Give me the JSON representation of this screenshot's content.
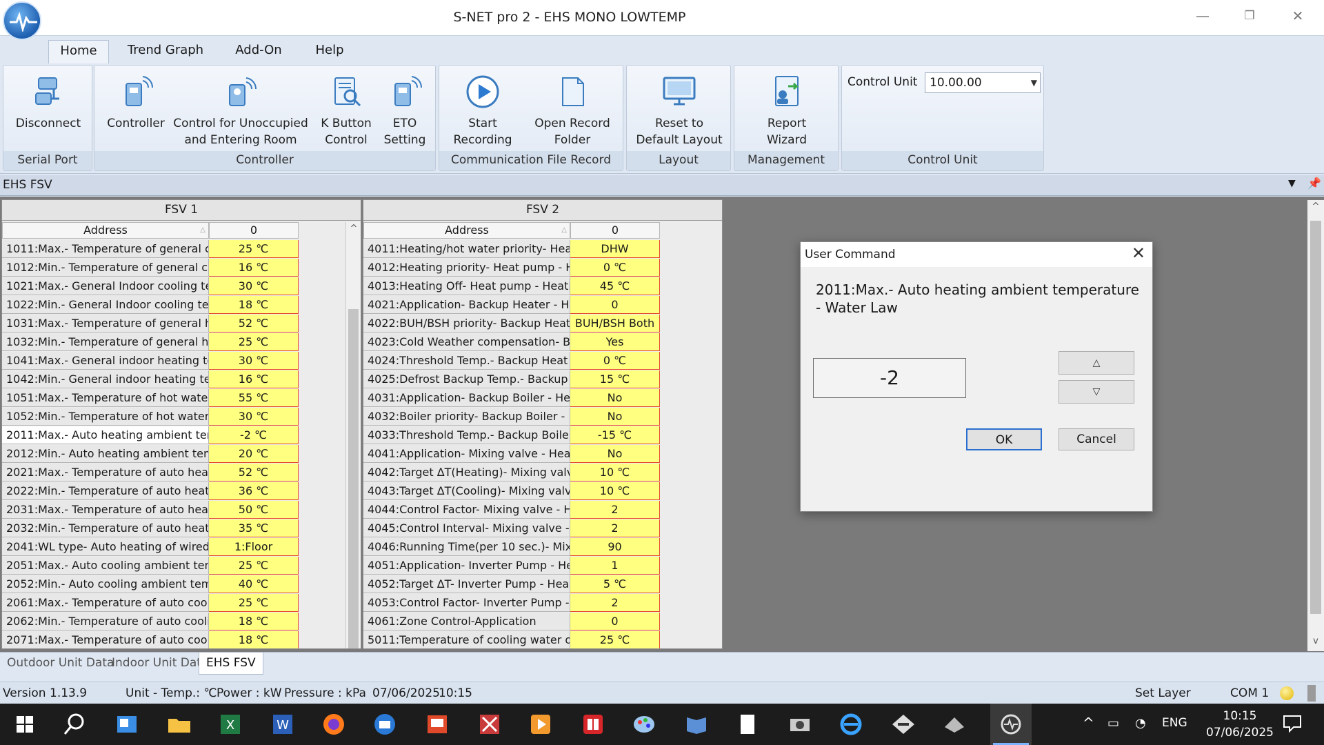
{
  "window": {
    "title": "S-NET pro 2 - EHS MONO LOWTEMP",
    "minimize_glyph": "—",
    "restore_glyph": "❐",
    "close_glyph": "✕"
  },
  "ribbon_tabs": [
    "Home",
    "Trend Graph",
    "Add-On",
    "Help"
  ],
  "ribbon": {
    "groups": {
      "serial_port": "Serial Port",
      "controller": "Controller",
      "communication": "Communication",
      "file_record": "File Record",
      "layout": "Layout",
      "management": "Management",
      "control_unit": "Control Unit"
    },
    "buttons": {
      "disconnect": "Disconnect",
      "controller": "Controller",
      "control_unoccupied_1": "Control for Unoccupied",
      "control_unoccupied_2": "and Entering Room",
      "k_button_1": "K Button",
      "k_button_2": "Control",
      "eto_1": "ETO",
      "eto_2": "Setting",
      "start_recording_1": "Start",
      "start_recording_2": "Recording",
      "open_record_1": "Open Record",
      "open_record_2": "Folder",
      "reset_layout_1": "Reset to",
      "reset_layout_2": "Default Layout",
      "report_wizard_1": "Report",
      "report_wizard_2": "Wizard"
    },
    "control_unit_label": "Control Unit",
    "control_unit_value": "10.00.00"
  },
  "panel": {
    "title": "EHS FSV"
  },
  "fsv1": {
    "title": "FSV 1",
    "col_address": "Address",
    "col_value": "0",
    "rows": [
      {
        "address": "1011:Max.- Temperature of general c",
        "value": "25 ℃"
      },
      {
        "address": "1012:Min.- Temperature of general c",
        "value": "16 ℃"
      },
      {
        "address": "1021:Max.- General Indoor cooling te",
        "value": "30 ℃"
      },
      {
        "address": "1022:Min.- General Indoor cooling te",
        "value": "18 ℃"
      },
      {
        "address": "1031:Max.- Temperature of general h",
        "value": "52 ℃"
      },
      {
        "address": "1032:Min.- Temperature of general h",
        "value": "25 ℃"
      },
      {
        "address": "1041:Max.- General indoor heating te",
        "value": "30 ℃"
      },
      {
        "address": "1042:Min.- General indoor heating te",
        "value": "16 ℃"
      },
      {
        "address": "1051:Max.- Temperature of hot water",
        "value": "55 ℃"
      },
      {
        "address": "1052:Min.- Temperature of hot water",
        "value": "30 ℃"
      },
      {
        "address": "2011:Max.- Auto heating ambient tem",
        "value": "-2 ℃"
      },
      {
        "address": "2012:Min.- Auto heating ambient tem",
        "value": "20 ℃"
      },
      {
        "address": "2021:Max.- Temperature of auto heat",
        "value": "52 ℃"
      },
      {
        "address": "2022:Min.- Temperature of auto heati",
        "value": "36 ℃"
      },
      {
        "address": "2031:Max.- Temperature of auto heat",
        "value": "50 ℃"
      },
      {
        "address": "2032:Min.- Temperature of auto heati",
        "value": "35 ℃"
      },
      {
        "address": "2041:WL type- Auto heating of wired",
        "value": "1:Floor"
      },
      {
        "address": "2051:Max.- Auto cooling ambient tem",
        "value": "25 ℃"
      },
      {
        "address": "2052:Min.- Auto cooling ambient tem",
        "value": "40 ℃"
      },
      {
        "address": "2061:Max.- Temperature of auto cooli",
        "value": "25 ℃"
      },
      {
        "address": "2062:Min.- Temperature of auto cooli",
        "value": "18 ℃"
      },
      {
        "address": "2071:Max.- Temperature of auto cooli",
        "value": "18 ℃"
      }
    ]
  },
  "fsv2": {
    "title": "FSV 2",
    "col_address": "Address",
    "col_value": "0",
    "rows": [
      {
        "address": "4011:Heating/hot water priority- Heat",
        "value": "DHW"
      },
      {
        "address": "4012:Heating priority- Heat pump - H",
        "value": "0 ℃"
      },
      {
        "address": "4013:Heating Off- Heat pump - Heati",
        "value": "45 ℃"
      },
      {
        "address": "4021:Application- Backup Heater - H",
        "value": "0"
      },
      {
        "address": "4022:BUH/BSH priority- Backup Heat",
        "value": "BUH/BSH Both"
      },
      {
        "address": "4023:Cold Weather compensation- B",
        "value": "Yes"
      },
      {
        "address": "4024:Threshold Temp.- Backup Heat",
        "value": "0 ℃"
      },
      {
        "address": "4025:Defrost Backup Temp.- Backup",
        "value": "15 ℃"
      },
      {
        "address": "4031:Application- Backup Boiler - He",
        "value": "No"
      },
      {
        "address": "4032:Boiler priority- Backup Boiler -",
        "value": "No"
      },
      {
        "address": "4033:Threshold Temp.- Backup Boile",
        "value": "-15 ℃"
      },
      {
        "address": "4041:Application- Mixing valve - Heat",
        "value": "No"
      },
      {
        "address": "4042:Target ΔT(Heating)- Mixing valv",
        "value": "10 ℃"
      },
      {
        "address": "4043:Target ΔT(Cooling)- Mixing valv",
        "value": "10 ℃"
      },
      {
        "address": "4044:Control Factor- Mixing valve - H",
        "value": "2"
      },
      {
        "address": "4045:Control Interval- Mixing valve -",
        "value": "2"
      },
      {
        "address": "4046:Running Time(per 10 sec.)- Mix",
        "value": "90"
      },
      {
        "address": "4051:Application- Inverter Pump - He",
        "value": "1"
      },
      {
        "address": "4052:Target ΔT- Inverter Pump - Hea",
        "value": "5 ℃"
      },
      {
        "address": "4053:Control Factor- Inverter Pump -",
        "value": "2"
      },
      {
        "address": "4061:Zone Control-Application",
        "value": "0"
      },
      {
        "address": "5011:Temperature of cooling water o",
        "value": "25 ℃"
      }
    ]
  },
  "dialog": {
    "title": "User Command",
    "message": "2011:Max.- Auto heating ambient temperature - Water Law",
    "value": "-2",
    "up_glyph": "△",
    "down_glyph": "▽",
    "ok_label": "OK",
    "cancel_label": "Cancel"
  },
  "bottom_tabs": [
    "Outdoor Unit Data",
    "Indoor Unit Data",
    "EHS FSV"
  ],
  "status": {
    "version_label": "Version",
    "version": "1.13.9",
    "unit_temp": "Unit - Temp.: ℃",
    "power": "Power : kW",
    "pressure": "Pressure : kPa",
    "date": "07/06/2025",
    "time": "10:15",
    "set_layer": "Set Layer",
    "com_port": "COM 1"
  },
  "tray": {
    "lang": "ENG",
    "time": "10:15",
    "date": "07/06/2025"
  },
  "colors": {
    "value_cell": "#ffff80",
    "value_border": "#e5492f",
    "accent": "#2a6fcf"
  }
}
